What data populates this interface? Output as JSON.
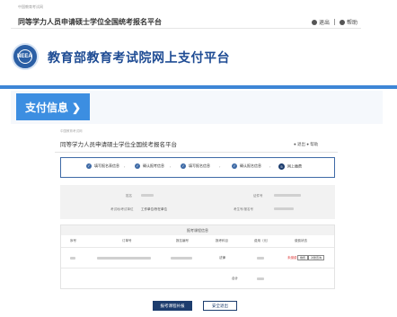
{
  "outer": {
    "small_label": "中国教育考试网",
    "title": "同等学力人员申请硕士学位全国统考报名平台",
    "user_label": "退出",
    "help_label": "帮助",
    "logo_text": "NEEA",
    "org_name": "教育部教育考试院网上支付平台"
  },
  "pay_tab": {
    "label": "支付信息",
    "arrow": "❯"
  },
  "inner": {
    "small_label": "中国教育考试网",
    "title": "同等学力人员申请硕士学位全国统考报名平台",
    "user_label": "退出",
    "help_label": "帮助",
    "steps": [
      {
        "label": "填写报名表信息",
        "mark": "✓"
      },
      {
        "label": "确认报考信息",
        "mark": "✓"
      },
      {
        "label": "填写报名信息",
        "mark": "✓"
      },
      {
        "label": "确认报名信息",
        "mark": "✓"
      },
      {
        "label": "网上缴费",
        "mark": "5"
      }
    ],
    "info": {
      "name_label": "姓名",
      "id_label": "证件号",
      "unit_label": "考试地/考试单位",
      "unit_value": "工作单位/所在单位",
      "exam_label": "考生号/报名号"
    },
    "table": {
      "caption": "报考课程信息",
      "headers": [
        "序号",
        "订单号",
        "报名编号",
        "报考科目",
        "费用（元）",
        "缴费状态"
      ],
      "row": {
        "subject": "法律",
        "status": "未缴费",
        "pay_btn": "缴费",
        "check_btn": "对账查询"
      },
      "total_label": "合计"
    },
    "primary_button": "报考课程补报",
    "secondary_button": "安全退出"
  }
}
